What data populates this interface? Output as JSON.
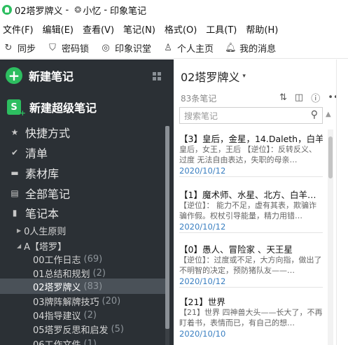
{
  "window": {
    "title_note": "02塔罗牌义",
    "title_sep": "-",
    "user": "小忆",
    "app_name": "印象笔记",
    "user_sep": "-"
  },
  "menu": [
    "文件(F)",
    "编辑(E)",
    "查看(V)",
    "笔记(N)",
    "格式(O)",
    "工具(T)",
    "帮助(H)"
  ],
  "toolbar": [
    {
      "icon": "sync-icon",
      "glyph": "↻",
      "label": "同步"
    },
    {
      "icon": "shield-lock-icon",
      "glyph": "⛉",
      "label": "密码锁"
    },
    {
      "icon": "classroom-icon",
      "glyph": "◎",
      "label": "印象识堂"
    },
    {
      "icon": "person-icon",
      "glyph": "♙",
      "label": "个人主页"
    },
    {
      "icon": "bell-icon",
      "glyph": "♫",
      "label": "我的消息"
    }
  ],
  "sidebar": {
    "new_note": "新建笔记",
    "new_super_note": "新建超级笔记",
    "super_icon_letter": "S",
    "nav": [
      {
        "icon": "star-icon",
        "glyph": "★",
        "label": "快捷方式"
      },
      {
        "icon": "check-circle-icon",
        "glyph": "✔",
        "label": "清单"
      },
      {
        "icon": "materials-icon",
        "glyph": "▬",
        "label": "素材库"
      },
      {
        "icon": "notes-icon",
        "glyph": "▤",
        "label": "全部笔记"
      },
      {
        "icon": "notebook-icon",
        "glyph": "▮",
        "label": "笔记本"
      }
    ],
    "tree": [
      {
        "label": "0人生原则",
        "count": "",
        "level": 1,
        "caret": "▶"
      },
      {
        "label": "A【塔罗】",
        "count": "",
        "level": 1,
        "caret": "◢"
      },
      {
        "label": "00工作日志",
        "count": "(69)",
        "level": 2,
        "caret": ""
      },
      {
        "label": "01总结和规划",
        "count": "(2)",
        "level": 2,
        "caret": ""
      },
      {
        "label": "02塔罗牌义",
        "count": "(83)",
        "level": 2,
        "caret": "",
        "selected": true
      },
      {
        "label": "03牌阵解牌技巧",
        "count": "(20)",
        "level": 2,
        "caret": ""
      },
      {
        "label": "04指导建议",
        "count": "(2)",
        "level": 2,
        "caret": ""
      },
      {
        "label": "05塔罗反思和启发",
        "count": "(5)",
        "level": 2,
        "caret": ""
      },
      {
        "label": "06工作文件",
        "count": "(1)",
        "level": 2,
        "caret": ""
      }
    ]
  },
  "notebook": {
    "title": "02塔罗牌义",
    "count_label": "83条笔记",
    "search_placeholder": "搜索笔记",
    "notes": [
      {
        "title": "【3】皇后，金星，14.Daleth，白羊…",
        "snippet": "皇后，女王，王后 【逆位】：反转反义、过度 无法自由表达，失职的母亲…",
        "date": "2020/10/12"
      },
      {
        "title": "【1】魔术师、水星、北方、白羊…",
        "snippet": "【逆位】： 能力不足，虚有其表，欺骗诈骗作假。权杖引导能量，精力用错…",
        "date": "2020/10/12"
      },
      {
        "title": "【0】愚人、冒险家 、天王星",
        "snippet": "【逆位】：过度或不足，大方向指，做出了不明智的决定，预防猪队友——…",
        "date": "2020/10/12"
      },
      {
        "title": "【21】世界",
        "snippet": "【21】世界 四神兽大头——长大了，不再盯着书，表情而已，有自己的想…",
        "date": "2020/10/10"
      }
    ]
  }
}
